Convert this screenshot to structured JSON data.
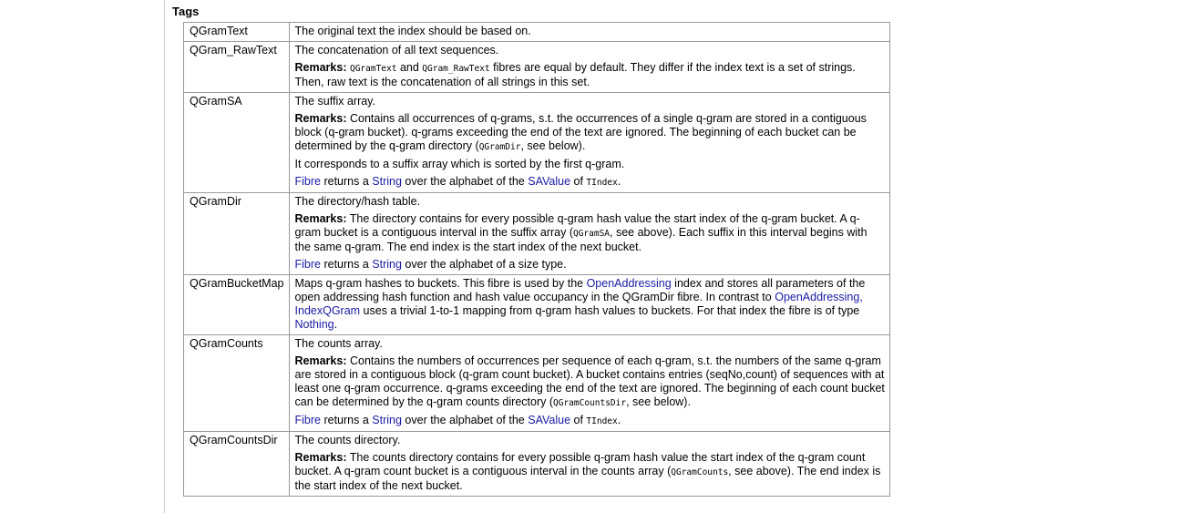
{
  "section": {
    "title": "Tags"
  },
  "rows": [
    {
      "tag": "QGramText",
      "lines": [
        "The original text the index should be based on."
      ]
    },
    {
      "tag": "QGram_RawText",
      "summary": "The concatenation of all text sequences.",
      "remarks_label": "Remarks:",
      "code1": "QGramText",
      "and": " and ",
      "code2": "QGram_RawText",
      "text": " fibres are equal by default. They differ if the index text is a set of strings. Then, raw text is the concatenation of all strings in this set."
    },
    {
      "tag": "QGramSA",
      "summary": "The suffix array.",
      "remarks_label": "Remarks:",
      "remarks_text": " Contains all occurrences of q-grams, s.t. the occurrences of a single q-gram are stored in a contiguous block (q-gram bucket). q-grams exceeding the end of the text are ignored. The beginning of each bucket can be determined by the q-gram directory (",
      "code": "QGramDir",
      "remarks_tail": ", see below).",
      "extra": "It corresponds to a suffix array which is sorted by the first q-gram.",
      "fibre": "Fibre",
      "returns": " returns a ",
      "string": "String",
      "over": " over the alphabet of the ",
      "savalue": "SAValue",
      "of": " of ",
      "tindex": "TIndex",
      "dot": "."
    },
    {
      "tag": "QGramDir",
      "summary": "The directory/hash table.",
      "remarks_label": "Remarks:",
      "remarks_text": " The directory contains for every possible q-gram hash value the start index of the q-gram bucket. A q-gram bucket is a contiguous interval in the suffix array (",
      "code": "QGramSA",
      "remarks_tail": ", see above). Each suffix in this interval begins with the same q-gram. The end index is the start index of the next bucket.",
      "fibre": "Fibre",
      "returns": " returns a ",
      "string": "String",
      "tail": " over the alphabet of a size type."
    },
    {
      "tag": "QGramBucketMap",
      "t1": "Maps q-gram hashes to buckets. This fibre is used by the ",
      "link1": "OpenAddressing",
      "t2": " index and stores all parameters of the open addressing hash function and hash value occupancy in the QGramDir fibre. In contrast to ",
      "link2": "OpenAddressing, IndexQGram",
      "t3": " uses a trivial 1-to-1 mapping from q-gram hash values to buckets. For that index the fibre is of type ",
      "link3": "Nothing",
      "t4": "."
    },
    {
      "tag": "QGramCounts",
      "summary": "The counts array.",
      "remarks_label": "Remarks:",
      "remarks_text": " Contains the numbers of occurrences per sequence of each q-gram, s.t. the numbers of the same q-gram are stored in a contiguous block (q-gram count bucket). A bucket contains entries (seqNo,count) of sequences with at least one q-gram occurrence. q-grams exceeding the end of the text are ignored. The beginning of each count bucket can be determined by the q-gram counts directory (",
      "code": "QGramCountsDir",
      "remarks_tail": ", see below).",
      "fibre": "Fibre",
      "returns": " returns a ",
      "string": "String",
      "over": " over the alphabet of the ",
      "savalue": "SAValue",
      "of": " of ",
      "tindex": "TIndex",
      "dot": "."
    },
    {
      "tag": "QGramCountsDir",
      "summary": "The counts directory.",
      "remarks_label": "Remarks:",
      "remarks_text": " The counts directory contains for every possible q-gram hash value the start index of the q-gram count bucket. A q-gram count bucket is a contiguous interval in the counts array (",
      "code": "QGramCounts",
      "remarks_tail": ", see above). The end index is the start index of the next bucket."
    }
  ]
}
